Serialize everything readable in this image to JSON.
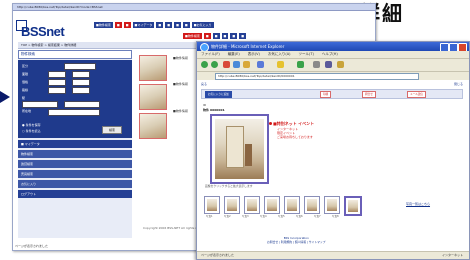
{
  "heading": "詳細",
  "back_window": {
    "title_bar": "http://cube:8080/bss-net/Top/detail/kenID?mode=BSSnet",
    "logo": "BSSnet",
    "top_menu": [
      "■物件検索",
      "■ ",
      "■ ",
      "■マイデータ",
      "■ ",
      "■ ",
      "■ ",
      "■ ",
      "■お気に入り"
    ],
    "second_menu": [
      "■物件検索",
      "■ ",
      "■ ",
      "■ ",
      "■ ",
      "■ ",
      "■ ",
      "■ "
    ],
    "breadcrumb": "TOP > 物件検索 > 検索結果 > 物件詳細",
    "search_title": "物件検索",
    "search_labels": [
      "区分",
      "面積",
      "価格",
      "路線",
      "駅",
      "所在地"
    ],
    "search_button": "検索",
    "radio_labels": [
      "● 条件を保存",
      "○ 条件を読込"
    ],
    "side_links": [
      "■ マイデータ",
      "物件検索",
      "賃貸検索",
      "売買検索",
      "お気に入り",
      "ログアウト"
    ],
    "content_rows": [
      "■物件情報",
      "■物件情報",
      "■物件情報"
    ],
    "row_buttons": [
      "詳細を見る",
      "詳細を見る",
      "詳細を見る"
    ],
    "footer": "Copyright 2006 BSS-NET All rights reserved.",
    "status": "ページが表示されました"
  },
  "front_window": {
    "title": "物件詳細 - Microsoft Internet Explorer",
    "menu": [
      "ファイル(F)",
      "編集(E)",
      "表示(V)",
      "お気に入り(A)",
      "ツール(T)",
      "ヘルプ(H)"
    ],
    "address": "http://cube:8080/bss-net/Top/detail/kenID/0000001",
    "page_top": "戻る",
    "close_link": "閉じる",
    "bar_buttons": [
      "お気に入りに追加",
      "印刷",
      "問合せ",
      "メール送信"
    ],
    "property_code": "ID",
    "property_code_value": "物件 0000001",
    "event_title": "■特別ネット イベント",
    "event_lines": [
      "インターネット",
      "限定イベント",
      "ご来場お待ちしております"
    ],
    "photo_caption": "画像をクリックすると拡大表示します",
    "thumb_labels": [
      "写真1",
      "写真2",
      "写真3",
      "写真4",
      "写真5",
      "写真6",
      "写真7",
      "写真8"
    ],
    "photo_link": "写真一覧はこちら",
    "footer_line1": "BSS Incorporation",
    "footer_line2": "お問合せ | 利用規約 | 個人情報 | サイトマップ",
    "status_left": "ページが表示されました",
    "status_zone": "インターネット"
  }
}
